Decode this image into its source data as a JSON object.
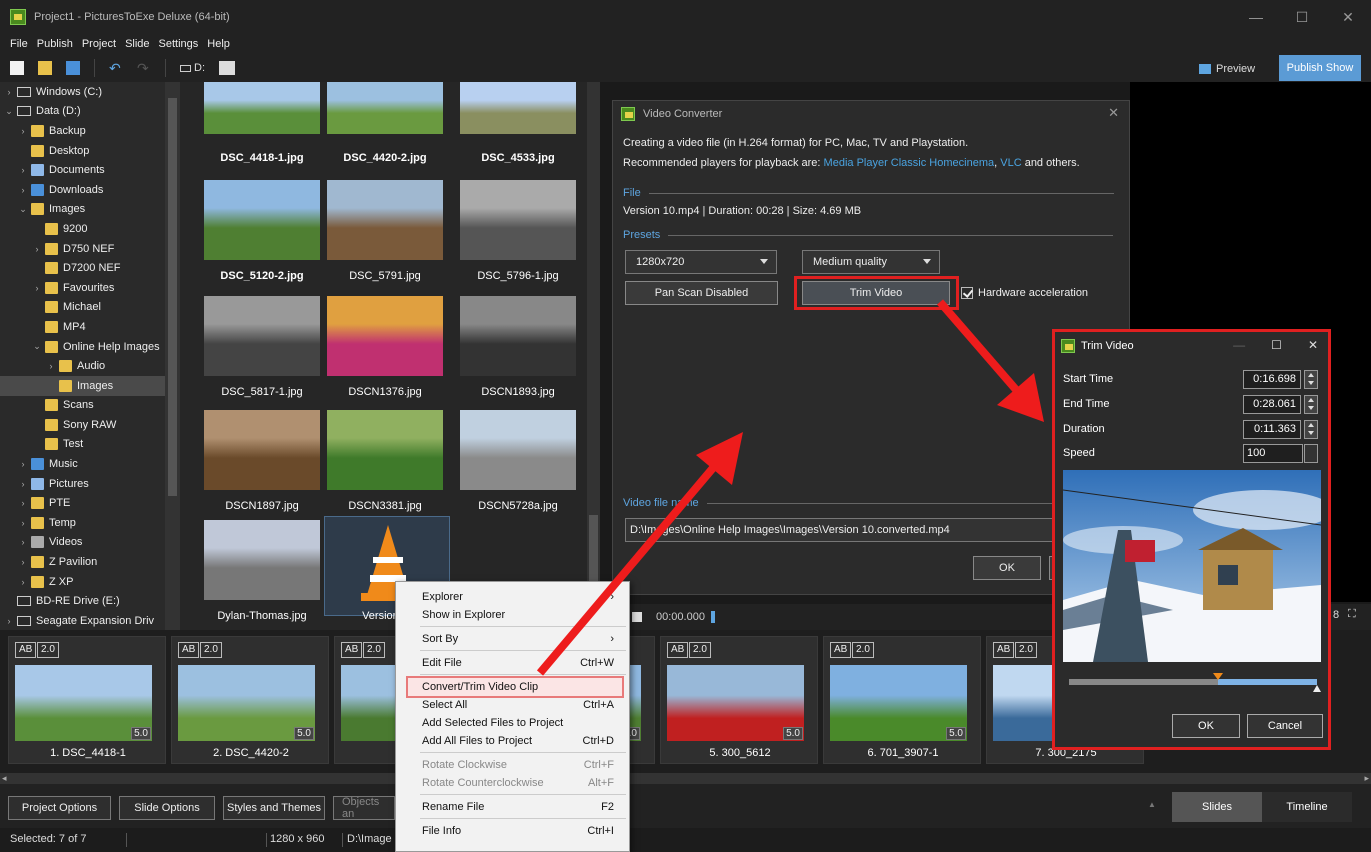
{
  "window": {
    "title": "Project1 - PicturesToExe Deluxe (64-bit)",
    "minimize": "—",
    "maximize": "☐",
    "close": "✕"
  },
  "menu": [
    "File",
    "Publish",
    "Project",
    "Slide",
    "Settings",
    "Help"
  ],
  "toolbar": {
    "drive": "D:",
    "preview": "Preview",
    "publish": "Publish Show"
  },
  "tree": [
    {
      "label": "Windows (C:)",
      "indent": 0,
      "kind": "drive",
      "chev": ">"
    },
    {
      "label": "Data (D:)",
      "indent": 0,
      "kind": "drive",
      "chev": "v"
    },
    {
      "label": "Backup",
      "indent": 1,
      "kind": "folder",
      "chev": ">"
    },
    {
      "label": "Desktop",
      "indent": 1,
      "kind": "folder",
      "chev": ""
    },
    {
      "label": "Documents",
      "indent": 1,
      "kind": "doc",
      "chev": ">"
    },
    {
      "label": "Downloads",
      "indent": 1,
      "kind": "down",
      "chev": ">"
    },
    {
      "label": "Images",
      "indent": 1,
      "kind": "folder",
      "chev": "v"
    },
    {
      "label": "9200",
      "indent": 2,
      "kind": "folder",
      "chev": ""
    },
    {
      "label": "D750 NEF",
      "indent": 2,
      "kind": "folder",
      "chev": ">"
    },
    {
      "label": "D7200 NEF",
      "indent": 2,
      "kind": "folder",
      "chev": ""
    },
    {
      "label": "Favourites",
      "indent": 2,
      "kind": "folder",
      "chev": ">"
    },
    {
      "label": "Michael",
      "indent": 2,
      "kind": "folder",
      "chev": ""
    },
    {
      "label": "MP4",
      "indent": 2,
      "kind": "folder",
      "chev": ""
    },
    {
      "label": "Online Help Images",
      "indent": 2,
      "kind": "folder",
      "chev": "v"
    },
    {
      "label": "Audio",
      "indent": 3,
      "kind": "folder",
      "chev": ">"
    },
    {
      "label": "Images",
      "indent": 3,
      "kind": "folder",
      "chev": "",
      "selected": true
    },
    {
      "label": "Scans",
      "indent": 2,
      "kind": "folder",
      "chev": ""
    },
    {
      "label": "Sony RAW",
      "indent": 2,
      "kind": "folder",
      "chev": ""
    },
    {
      "label": "Test",
      "indent": 2,
      "kind": "folder",
      "chev": ""
    },
    {
      "label": "Music",
      "indent": 1,
      "kind": "music",
      "chev": ">"
    },
    {
      "label": "Pictures",
      "indent": 1,
      "kind": "pic",
      "chev": ">"
    },
    {
      "label": "PTE",
      "indent": 1,
      "kind": "folder",
      "chev": ">"
    },
    {
      "label": "Temp",
      "indent": 1,
      "kind": "folder",
      "chev": ">"
    },
    {
      "label": "Videos",
      "indent": 1,
      "kind": "vid",
      "chev": ">"
    },
    {
      "label": "Z Pavilion",
      "indent": 1,
      "kind": "folder",
      "chev": ">"
    },
    {
      "label": "Z XP",
      "indent": 1,
      "kind": "folder",
      "chev": ">"
    },
    {
      "label": "BD-RE Drive (E:)",
      "indent": 0,
      "kind": "drive",
      "chev": ""
    },
    {
      "label": "Seagate Expansion Driv",
      "indent": 0,
      "kind": "drive",
      "chev": ">"
    }
  ],
  "files": [
    {
      "name": "DSC_4418-1.jpg",
      "bold": true,
      "c1": "#5a8f3a",
      "c2": "#a8c8e8"
    },
    {
      "name": "DSC_4420-2.jpg",
      "bold": true,
      "c1": "#6a9a40",
      "c2": "#9cc0e0"
    },
    {
      "name": "DSC_4533.jpg",
      "bold": true,
      "c1": "#8a8f60",
      "c2": "#b8d0f0"
    },
    {
      "name": "DSC_5120-2.jpg",
      "bold": true,
      "c1": "#4f7f32",
      "c2": "#8fb8e0"
    },
    {
      "name": "DSC_5791.jpg",
      "bold": false,
      "c1": "#7a5a3a",
      "c2": "#a0b8d0"
    },
    {
      "name": "DSC_5796-1.jpg",
      "bold": false,
      "c1": "#555",
      "c2": "#aaa"
    },
    {
      "name": "DSC_5817-1.jpg",
      "bold": false,
      "c1": "#444",
      "c2": "#999"
    },
    {
      "name": "DSCN1376.jpg",
      "bold": false,
      "c1": "#c03070",
      "c2": "#e0a040"
    },
    {
      "name": "DSCN1893.jpg",
      "bold": false,
      "c1": "#333",
      "c2": "#888"
    },
    {
      "name": "DSCN1897.jpg",
      "bold": false,
      "c1": "#6a4a2a",
      "c2": "#b09070"
    },
    {
      "name": "DSCN3381.jpg",
      "bold": false,
      "c1": "#3f7a2a",
      "c2": "#90b060"
    },
    {
      "name": "DSCN5728a.jpg",
      "bold": false,
      "c1": "#8a8a8a",
      "c2": "#c0d0e0"
    },
    {
      "name": "Dylan-Thomas.jpg",
      "bold": false,
      "c1": "#777",
      "c2": "#c0c8d8"
    },
    {
      "name": "Version 1",
      "bold": false,
      "c1": "#f08a1a",
      "c2": "#ffffff"
    }
  ],
  "video_converter": {
    "title": "Video Converter",
    "line1": "Creating a video file (in H.264 format) for PC, Mac, TV and Playstation.",
    "line2_pre": "Recommended players for playback are: ",
    "link1": "Media Player Classic Homecinema",
    "sep": ", ",
    "link2": "VLC",
    "line2_post": " and others.",
    "file_legend": "File",
    "file_info": "Version 10.mp4  |  Duration: 00:28  |  Size: 4.69 MB",
    "presets_legend": "Presets",
    "resolution": "1280x720",
    "quality": "Medium quality",
    "pan_scan": "Pan  Scan Disabled",
    "trim": "Trim Video",
    "hw": "Hardware acceleration",
    "filename_legend": "Video file name",
    "filename": "D:\\Images\\Online Help Images\\Images\\Version 10.converted.mp4",
    "ok": "OK"
  },
  "player": {
    "time": "00:00.000",
    "right_char": "8",
    "expand": "⛶"
  },
  "trim_video": {
    "title": "Trim Video",
    "start_label": "Start Time",
    "start": "0:16.698",
    "end_label": "End Time",
    "end": "0:28.061",
    "dur_label": "Duration",
    "dur": "0:11.363",
    "speed_label": "Speed",
    "speed": "100",
    "range_start": 0.6,
    "range_end": 1.0,
    "ok": "OK",
    "cancel": "Cancel"
  },
  "slides": [
    {
      "name": "1. DSC_4418-1",
      "c1": "#5a8f3a",
      "c2": "#a8c8e8"
    },
    {
      "name": "2. DSC_4420-2",
      "c1": "#6a9a40",
      "c2": "#9cc0e0"
    },
    {
      "name": "3",
      "c1": "#4a7a30",
      "c2": "#9cc0e0"
    },
    {
      "name": "",
      "c1": "#4f7f32",
      "c2": "#8fb8e0"
    },
    {
      "name": "5. 300_5612",
      "c1": "#c02020",
      "c2": "#98b8d8"
    },
    {
      "name": "6. 701_3907-1",
      "c1": "#4a8a2a",
      "c2": "#7fb0e0"
    },
    {
      "name": "7. 300_2175",
      "c1": "#3a6a9a",
      "c2": "#c0d8f0"
    }
  ],
  "slide_badge": {
    "ab": "AB",
    "time": "2.0",
    "dur": "5.0"
  },
  "bottom": {
    "project_options": "Project Options",
    "slide_options": "Slide Options",
    "styles": "Styles and Themes",
    "objects": "Objects an",
    "tab_slides": "Slides",
    "tab_timeline": "Timeline"
  },
  "status": {
    "selected": "Selected: 7 of 7",
    "size": "1280 x 960",
    "path": "D:\\Image"
  },
  "context_menu": [
    {
      "label": "Explorer",
      "key": "›",
      "sep_after": false
    },
    {
      "label": "Show in Explorer",
      "key": "",
      "sep_after": true
    },
    {
      "label": "Sort By",
      "key": "›",
      "sep_after": true
    },
    {
      "label": "Edit File",
      "key": "Ctrl+W",
      "sep_after": true
    },
    {
      "label": "Convert/Trim Video Clip",
      "key": "",
      "sep_after": false,
      "hl": true
    },
    {
      "label": "Select All",
      "key": "Ctrl+A",
      "sep_after": false
    },
    {
      "label": "Add Selected Files to Project",
      "key": "",
      "sep_after": false
    },
    {
      "label": "Add All Files to Project",
      "key": "Ctrl+D",
      "sep_after": true
    },
    {
      "label": "Rotate Clockwise",
      "key": "Ctrl+F",
      "sep_after": false,
      "dis": true
    },
    {
      "label": "Rotate Counterclockwise",
      "key": "Alt+F",
      "sep_after": true,
      "dis": true
    },
    {
      "label": "Rename File",
      "key": "F2",
      "sep_after": true
    },
    {
      "label": "File Info",
      "key": "Ctrl+I",
      "sep_after": false
    }
  ]
}
